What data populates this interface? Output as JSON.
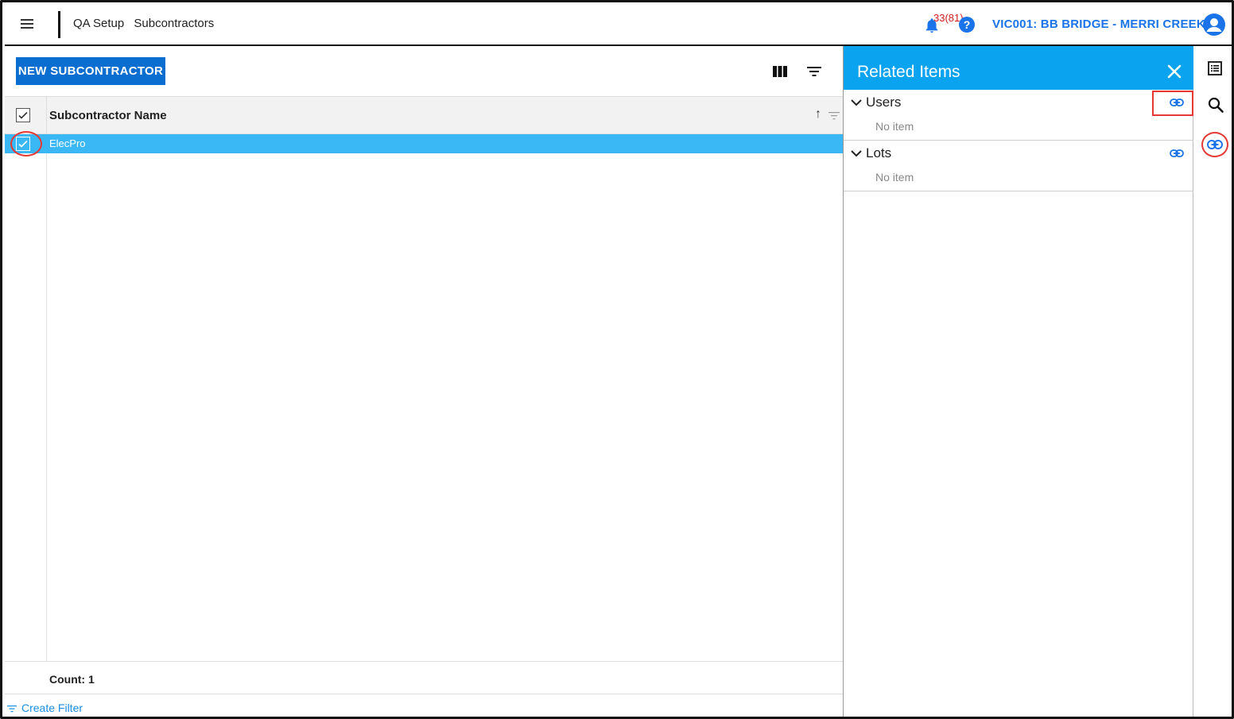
{
  "header": {
    "breadcrumb_1": "QA Setup",
    "breadcrumb_2": "Subcontractors",
    "notification_count": "33(81)",
    "help_glyph": "?",
    "project_name": "VIC001: BB BRIDGE - MERRI CREEK",
    "icons": [
      "hamburger-icon",
      "bell-icon",
      "help-icon",
      "account-icon"
    ]
  },
  "toolbar": {
    "new_button_label": "NEW SUBCONTRACTOR",
    "icons": [
      "columns-icon",
      "filter-icon"
    ]
  },
  "grid": {
    "column_header": "Subcontractor Name",
    "sort_glyph": "↑",
    "rows": [
      {
        "name": "ElecPro",
        "selected": true
      }
    ],
    "count_label": "Count: 1",
    "create_filter_label": "Create Filter"
  },
  "related_panel": {
    "title": "Related Items",
    "sections": [
      {
        "label": "Users",
        "empty_text": "No item"
      },
      {
        "label": "Lots",
        "empty_text": "No item"
      }
    ]
  },
  "right_rail": {
    "icons": [
      "list-icon",
      "search-icon",
      "link-icon"
    ]
  },
  "colors": {
    "accent": "#0a6ed1",
    "panel_header": "#0aa3f0",
    "selected_row": "#3ab7f5",
    "annotation_red": "#e53935",
    "link_blue": "#1a73e8"
  }
}
